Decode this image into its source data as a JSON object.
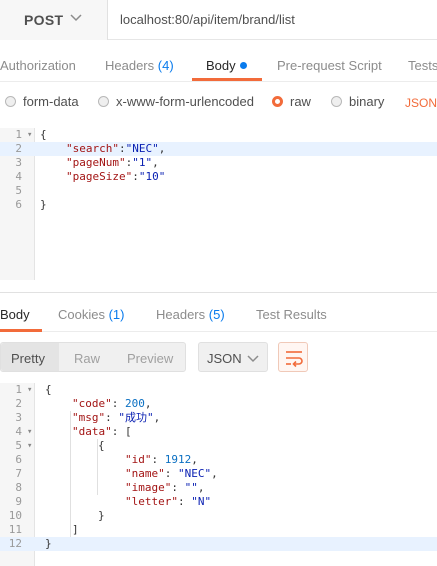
{
  "request": {
    "method": "POST",
    "url": "localhost:80/api/item/brand/list"
  },
  "request_tabs": [
    {
      "label": "Authorization"
    },
    {
      "label": "Headers",
      "count": "(4)"
    },
    {
      "label": "Body",
      "active": true,
      "has_dot": true
    },
    {
      "label": "Pre-request Script"
    },
    {
      "label": "Tests"
    }
  ],
  "body_types": [
    {
      "label": "form-data",
      "checked": false
    },
    {
      "label": "x-www-form-urlencoded",
      "checked": false
    },
    {
      "label": "raw",
      "checked": true
    },
    {
      "label": "binary",
      "checked": false
    }
  ],
  "raw_format": "JSON",
  "request_body_lines": [
    {
      "n": "1",
      "text": "{"
    },
    {
      "n": "2",
      "key": "\"search\"",
      "sep": ":",
      "val": "\"NEC\"",
      "trail": ","
    },
    {
      "n": "3",
      "key": "\"pageNum\"",
      "sep": ":",
      "val": "\"1\"",
      "trail": ","
    },
    {
      "n": "4",
      "key": "\"pageSize\"",
      "sep": ":",
      "val": "\"10\"",
      "trail": ""
    },
    {
      "n": "5",
      "text": ""
    },
    {
      "n": "6",
      "text": "}"
    }
  ],
  "response_tabs": [
    {
      "label": "Body",
      "active": true
    },
    {
      "label": "Cookies",
      "count": "(1)"
    },
    {
      "label": "Headers",
      "count": "(5)"
    },
    {
      "label": "Test Results"
    }
  ],
  "response_view": {
    "modes": [
      "Pretty",
      "Raw",
      "Preview"
    ],
    "active_mode": "Pretty",
    "format": "JSON"
  },
  "response_body_lines": [
    {
      "n": "1",
      "indent": "",
      "text": "{"
    },
    {
      "n": "2",
      "indent": "    ",
      "key": "\"code\"",
      "sep": ": ",
      "val": "200",
      "num": true,
      "trail": ","
    },
    {
      "n": "3",
      "indent": "    ",
      "key": "\"msg\"",
      "sep": ": ",
      "val": "\"成功\"",
      "trail": ","
    },
    {
      "n": "4",
      "indent": "    ",
      "key": "\"data\"",
      "sep": ": ",
      "val": "[",
      "plain": true,
      "trail": ""
    },
    {
      "n": "5",
      "indent": "        ",
      "text": "{"
    },
    {
      "n": "6",
      "indent": "            ",
      "key": "\"id\"",
      "sep": ": ",
      "val": "1912",
      "num": true,
      "trail": ","
    },
    {
      "n": "7",
      "indent": "            ",
      "key": "\"name\"",
      "sep": ": ",
      "val": "\"NEC\"",
      "trail": ","
    },
    {
      "n": "8",
      "indent": "            ",
      "key": "\"image\"",
      "sep": ": ",
      "val": "\"\"",
      "trail": ","
    },
    {
      "n": "9",
      "indent": "            ",
      "key": "\"letter\"",
      "sep": ": ",
      "val": "\"N\"",
      "trail": ""
    },
    {
      "n": "10",
      "indent": "        ",
      "text": "}"
    },
    {
      "n": "11",
      "indent": "    ",
      "text": "]"
    },
    {
      "n": "12",
      "indent": "",
      "text": "}"
    }
  ],
  "colors": {
    "accent": "#f26b3a",
    "link_blue": "#097bed",
    "json_key": "#a31515",
    "json_string": "#0b21b3",
    "json_number": "#0a6fc2"
  },
  "icons": {
    "method_dropdown": "chevron-down-icon",
    "format_dropdown": "chevron-down-icon",
    "wrap": "wrap-lines-icon"
  }
}
